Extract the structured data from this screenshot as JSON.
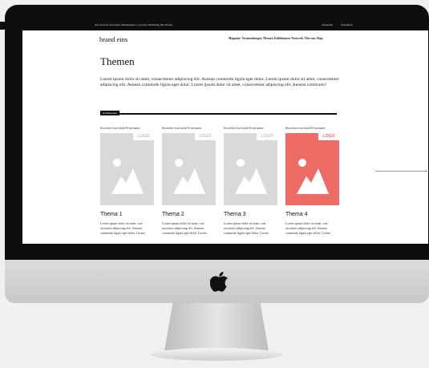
{
  "topbar": {
    "left_links": "Abo Podcast Newsletter Medienkunst Corporate Publishing Die Brouss",
    "login": "Anmelden",
    "cart": "Warenkorb"
  },
  "brand": "brand eins",
  "nav": [
    "Magazine",
    "Veranstaltungen",
    "Themen",
    "Kollektionen",
    "Netzwerk",
    "Über uns",
    "Shop"
  ],
  "page_title": "Themen",
  "intro": "Lorem ipsum dolor sit amet, consectetuer adipiscing elit. Aenean commodo ligula eget dolor. Lorem ipsum dolor sit amet, consectetuer adipiscing elit. Aenean commodo ligula eget dolor. Lorem ipsum dolor sit amet, consectetuer adipiscing elit. Aenean commodo?",
  "section_tag": "Kollektionen",
  "cards": [
    {
      "caption": "Kostenlos lesen dank Firmenname",
      "logo": "LOGO",
      "name": "Thema 1",
      "text": "Lorem ipsum dolor sit amet, con-sectetuer adipiscing elit. Aenean commodo ligula eget dolor. Lorem"
    },
    {
      "caption": "Kostenlos lesen dank Firmenname",
      "logo": "LOGO",
      "name": "Thema 2",
      "text": "Lorem ipsum dolor sit amet, con-sectetuer adipiscing elit. Aenean commodo ligula eget dolor. Lorem"
    },
    {
      "caption": "Kostenlos lesen dank Firmenname",
      "logo": "LOGO",
      "name": "Thema 3",
      "text": "Lorem ipsum dolor sit amet, con-sectetuer adipiscing elit. Aenean commodo ligula eget dolor. Lorem"
    },
    {
      "caption": "Kostenlos lesen dank Firmenname",
      "logo": "LOGO",
      "name": "Thema 4",
      "text": "Lorem ipsum dolor sit amet, con-sectetuer adipiscing elit. Aenean commodo ligula eget dolor. Lorem"
    }
  ],
  "colors": {
    "accent": "#ef6b66",
    "placeholder": "#d9d9d9",
    "bezel": "#0e0e0e"
  },
  "icons": {
    "apple": "apple-logo-icon",
    "image": "image-placeholder-icon"
  }
}
